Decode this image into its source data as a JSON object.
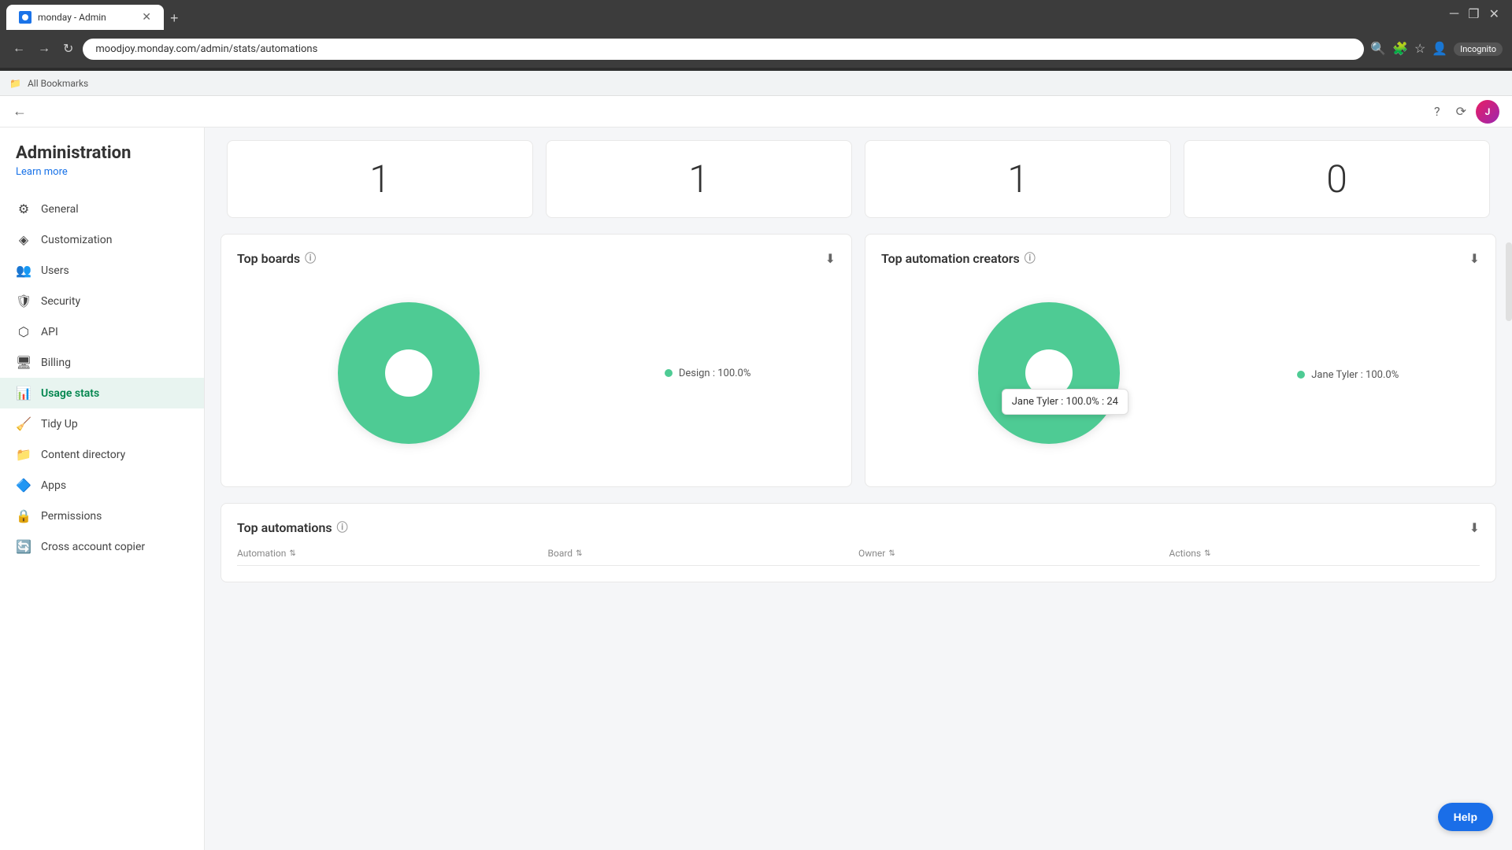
{
  "browser": {
    "tab_title": "monday - Admin",
    "url": "moodjoy.monday.com/admin/stats/automations",
    "new_tab_label": "+",
    "incognito_label": "Incognito",
    "bookmarks_label": "All Bookmarks"
  },
  "topbar": {
    "back_icon": "←",
    "help_icon": "?",
    "refresh_icon": "⟳"
  },
  "sidebar": {
    "title": "Administration",
    "learn_more": "Learn more",
    "items": [
      {
        "id": "general",
        "label": "General",
        "icon": "⚙"
      },
      {
        "id": "customization",
        "label": "Customization",
        "icon": "◈"
      },
      {
        "id": "users",
        "label": "Users",
        "icon": "👥"
      },
      {
        "id": "security",
        "label": "Security",
        "icon": "🛡"
      },
      {
        "id": "api",
        "label": "API",
        "icon": "⬡"
      },
      {
        "id": "billing",
        "label": "Billing",
        "icon": "🖥"
      },
      {
        "id": "usage-stats",
        "label": "Usage stats",
        "icon": "📊",
        "active": true
      },
      {
        "id": "tidy-up",
        "label": "Tidy Up",
        "icon": "🧹"
      },
      {
        "id": "content-directory",
        "label": "Content directory",
        "icon": "📁"
      },
      {
        "id": "apps",
        "label": "Apps",
        "icon": "🔷"
      },
      {
        "id": "permissions",
        "label": "Permissions",
        "icon": "🔒"
      },
      {
        "id": "cross-account",
        "label": "Cross account copier",
        "icon": "🔄"
      }
    ]
  },
  "stats": [
    {
      "value": "1"
    },
    {
      "value": "1"
    },
    {
      "value": "1"
    },
    {
      "value": "0"
    }
  ],
  "top_boards": {
    "title": "Top boards",
    "legend": [
      {
        "label": "Design : 100.0%",
        "color": "#4ecb94"
      }
    ]
  },
  "top_creators": {
    "title": "Top automation creators",
    "legend": [
      {
        "label": "Jane Tyler : 100.0%",
        "color": "#4ecb94"
      }
    ],
    "tooltip": "Jane Tyler : 100.0% : 24"
  },
  "top_automations": {
    "title": "Top automations",
    "columns": [
      {
        "label": "Automation"
      },
      {
        "label": "Board"
      },
      {
        "label": "Owner"
      },
      {
        "label": "Actions"
      }
    ]
  },
  "help_button": "Help"
}
